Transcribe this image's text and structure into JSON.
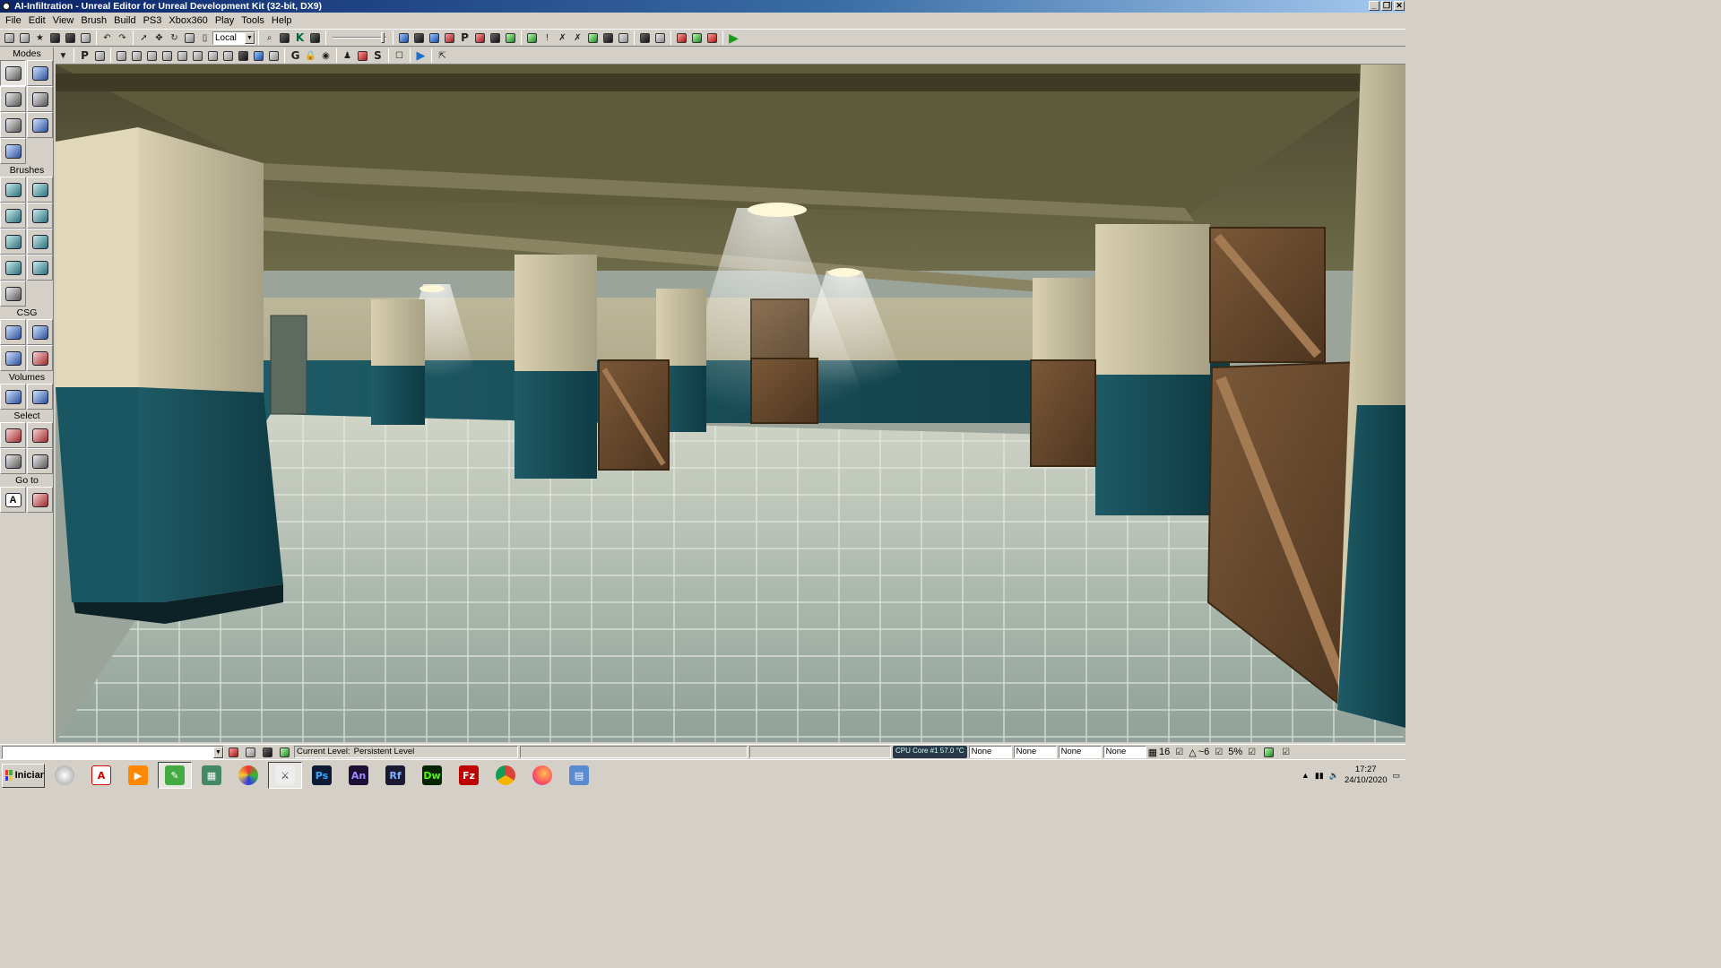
{
  "window": {
    "title": "AI-Infiltration - Unreal Editor for Unreal Development Kit (32-bit, DX9)"
  },
  "menu": [
    "File",
    "Edit",
    "View",
    "Brush",
    "Build",
    "PS3",
    "Xbox360",
    "Play",
    "Tools",
    "Help"
  ],
  "toolbar": {
    "coord_system": "Local",
    "icons_left": [
      "new-icon",
      "open-icon",
      "favorite-icon",
      "save-icon",
      "save-all-icon",
      "save-current-icon",
      "undo-icon",
      "redo-icon"
    ],
    "icons_select": [
      "select-icon",
      "translate-icon",
      "rotate-icon",
      "scale-icon",
      "scale-nonuniform-icon"
    ],
    "icons_mid": [
      "find-icon",
      "kismet-browser-icon",
      "kismet-icon",
      "content-browser-icon"
    ],
    "icons_build": [
      "build-geometry-icon",
      "build-lighting-icon",
      "build-paths-icon",
      "build-cover-icon",
      "build-all-icon",
      "lighting-quality-icon",
      "swarm-icon",
      "play-console-icon",
      "lighting-info-icon",
      "sentinel-icon",
      "map-check-icon",
      "cook-icon",
      "stream-icon",
      "pie-icon",
      "play-in-viewport-icon",
      "submit-icon",
      "mobile-icon",
      "play-icon"
    ]
  },
  "viewport_toolbar": {
    "letters": {
      "p": "P",
      "g": "G",
      "s": "S"
    },
    "icons": [
      "viewport-options-icon",
      "realtime-icon",
      "perspective-icon",
      "brush-wireframe-icon",
      "wireframe-icon",
      "unlit-icon",
      "lit-icon",
      "detail-lighting-icon",
      "lighting-only-icon",
      "light-complexity-icon",
      "texture-density-icon",
      "shader-complexity-icon",
      "game-view-icon",
      "lock-icon",
      "show-flags-icon",
      "camera-icon",
      "actor-icon",
      "stats-icon",
      "maximize-icon",
      "play-viewport-icon",
      "tear-off-icon"
    ]
  },
  "sidebar": {
    "modes_label": "Modes",
    "brushes_label": "Brushes",
    "csg_label": "CSG",
    "volumes_label": "Volumes",
    "select_label": "Select",
    "goto_label": "Go to"
  },
  "status": {
    "current_level_label": "Current Level:",
    "current_level": "Persistent Level",
    "cpu": "CPU Core #1   57.0 °C",
    "fields": [
      "None",
      "None",
      "None",
      "None"
    ],
    "grid": "16",
    "rotation": "~6",
    "scale": "5%"
  },
  "taskbar": {
    "start_label": "Iniciar",
    "apps": [
      {
        "name": "Ps",
        "color": "#0c1b33",
        "fg": "#31a8ff"
      },
      {
        "name": "An",
        "color": "#1b0d33",
        "fg": "#9a8cff"
      },
      {
        "name": "Rf",
        "color": "#1a1a33",
        "fg": "#7fb0ff"
      },
      {
        "name": "Dw",
        "color": "#072401",
        "fg": "#4cff00"
      },
      {
        "name": "Fz",
        "color": "#bf0000",
        "fg": "#ffffff"
      }
    ],
    "time": "17:27",
    "date": "24/10/2020"
  }
}
